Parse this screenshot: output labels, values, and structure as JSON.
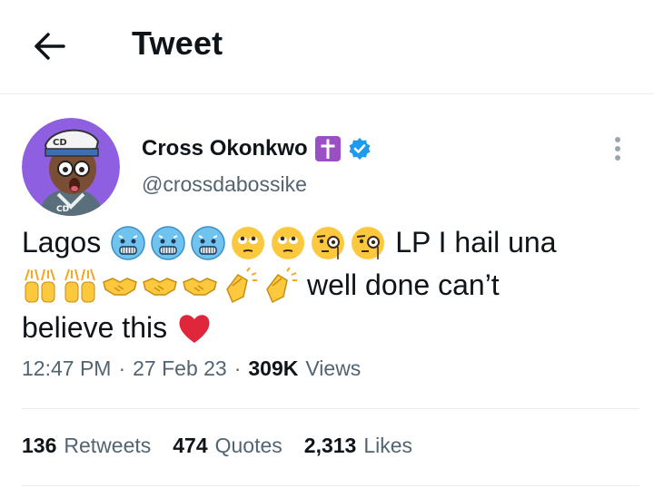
{
  "header": {
    "title": "Tweet"
  },
  "tweet": {
    "author_name": "Cross Okonkwo",
    "handle": "@crossdabossike",
    "text_line1": "Lagos",
    "text_line1_tail": "LP I hail una",
    "text_line2": "well done can’t",
    "text_line3": "believe this",
    "time": "12:47 PM",
    "separator": "·",
    "date": "27 Feb 23",
    "views_count": "309K",
    "views_label": "Views"
  },
  "stats": {
    "retweets_count": "136",
    "retweets_label": "Retweets",
    "quotes_count": "474",
    "quotes_label": "Quotes",
    "likes_count": "2,313",
    "likes_label": "Likes"
  },
  "icons": {
    "back": "back-arrow-icon",
    "verified": "verified-badge-icon",
    "cross": "latin-cross-icon",
    "more": "more-options-icon",
    "emoji": [
      "cold-face",
      "cold-face",
      "cold-face",
      "face-with-rolling-eyes",
      "face-with-rolling-eyes",
      "face-with-monocle",
      "face-with-monocle",
      "raising-hands",
      "raising-hands",
      "handshake",
      "handshake",
      "handshake",
      "clapping-hands",
      "clapping-hands",
      "red-heart"
    ]
  },
  "colors": {
    "accent": "#1d9bf0",
    "cross_bg": "#9b4fc4",
    "avatar_bg": "#8e5fe0",
    "heart": "#e0263b"
  }
}
